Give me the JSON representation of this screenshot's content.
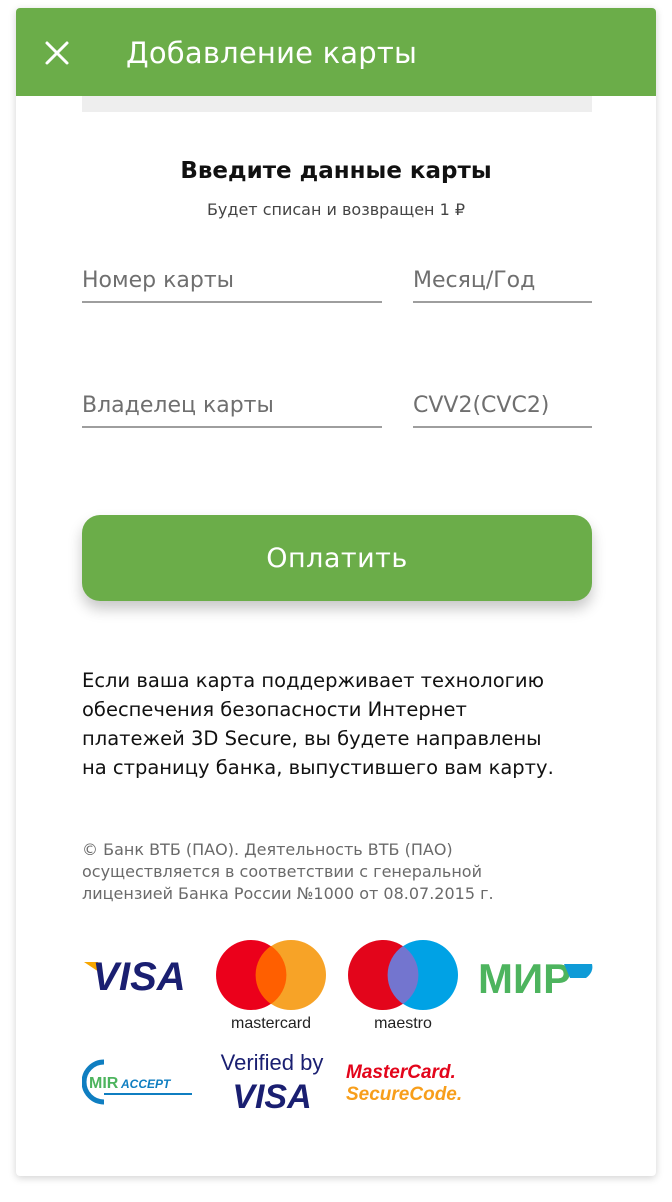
{
  "header": {
    "title": "Добавление карты",
    "close_icon": "close-icon"
  },
  "form": {
    "title": "Введите данные карты",
    "subtitle": "Будет списан и возвращен 1 ₽",
    "card_number_placeholder": "Номер карты",
    "expiry_placeholder": "Месяц/Год",
    "holder_placeholder": "Владелец карты",
    "cvv_placeholder": "CVV2(CVC2)"
  },
  "pay_button": {
    "label": "Оплатить"
  },
  "info": {
    "lines": [
      "Если ваша карта поддерживает технологию",
      "обеспечения безопасности Интернет",
      "платежей 3D Secure, вы будете направлены",
      "на страницу банка, выпустившего вам карту."
    ]
  },
  "legal": {
    "lines": [
      "© Банк ВТБ (ПАО). Деятельность ВТБ (ПАО)",
      "осуществляется в соответствии с генеральной",
      "лицензией Банка России №1000 от 08.07.2015 г."
    ]
  },
  "logos": {
    "visa": "VISA",
    "mastercard": "mastercard",
    "maestro": "maestro",
    "mir": "МИР",
    "mir_accept_mir": "MIR",
    "mir_accept_accept": "ACCEPT",
    "verified_by": "Verified by",
    "verified_visa": "VISA",
    "securecode_line1": "MasterCard.",
    "securecode_line2": "SecureCode."
  },
  "colors": {
    "accent_green": "#6bad49",
    "visa_blue": "#1a1f71",
    "visa_gold": "#f7a600",
    "mc_red": "#eb001b",
    "mc_yellow": "#f79e1b",
    "maestro_blue": "#00a2e5",
    "mir_green": "#4db45e",
    "mir_accept_blue": "#0f7ec1"
  }
}
